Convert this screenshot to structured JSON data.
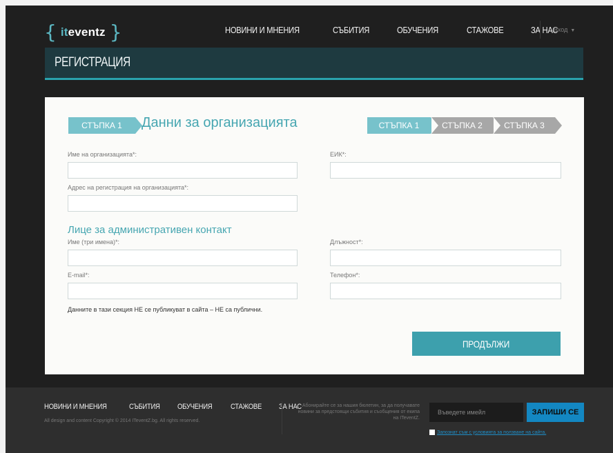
{
  "header": {
    "logo": {
      "brace_open": "{",
      "it": "it",
      "rest": "eventz",
      "brace_close": "}"
    },
    "nav": [
      "НОВИНИ И МНЕНИЯ",
      "СЪБИТИЯ",
      "ОБУЧЕНИЯ",
      "СТАЖОВЕ",
      "ЗА НАС"
    ],
    "login": "Вход",
    "login_caret": "▼"
  },
  "page_title": "РЕГИСТРАЦИЯ",
  "card": {
    "step_tag": "СТЪПКА 1",
    "title": "Данни за организацията",
    "progress": [
      {
        "label": "СТЪПКА 1",
        "state": "active"
      },
      {
        "label": "СТЪПКА 2",
        "state": "inactive"
      },
      {
        "label": "СТЪПКА 3",
        "state": "inactive"
      }
    ],
    "fields": {
      "org_name": {
        "label": "Име на организацията*:",
        "value": ""
      },
      "eik": {
        "label": "ЕИК*:",
        "value": ""
      },
      "org_address": {
        "label": "Адрес на регистрация на организацията*:",
        "value": ""
      },
      "contact_name": {
        "label": "Име (три имена)*:",
        "value": ""
      },
      "position": {
        "label": "Длъжност*:",
        "value": ""
      },
      "email": {
        "label": "E-mail*:",
        "value": ""
      },
      "phone": {
        "label": "Телефон*:",
        "value": ""
      }
    },
    "subsection_title": "Лице за административен контакт",
    "note": "Данните в тази секция НЕ се публикуват в сайта – НЕ са публични.",
    "continue_label": "ПРОДЪЛЖИ"
  },
  "footer": {
    "nav": [
      "НОВИНИ И МНЕНИЯ",
      "СЪБИТИЯ",
      "ОБУЧЕНИЯ",
      "СТАЖОВЕ",
      "ЗА НАС"
    ],
    "copyright": "All design and content Copyright © 2014 ITeventZ.bg. All rights reserved.",
    "subscribe_text": "Абонирайте се за нашия бюлетин, за да получавате новини за предстоящи събития и съобщения от екипа на ITeventZ.",
    "email_placeholder": "Въведете имейл",
    "subscribe_button": "ЗАПИШИ СЕ",
    "terms_label": "Запознат съм с условията за ползване на сайта."
  },
  "colors": {
    "accent": "#46a6b1",
    "step_active": "#77c2cb",
    "step_inactive": "#a7a7a7",
    "button": "#3da0ad",
    "subscribe_button": "#1387c2",
    "page_bar": "#1e3a40"
  }
}
